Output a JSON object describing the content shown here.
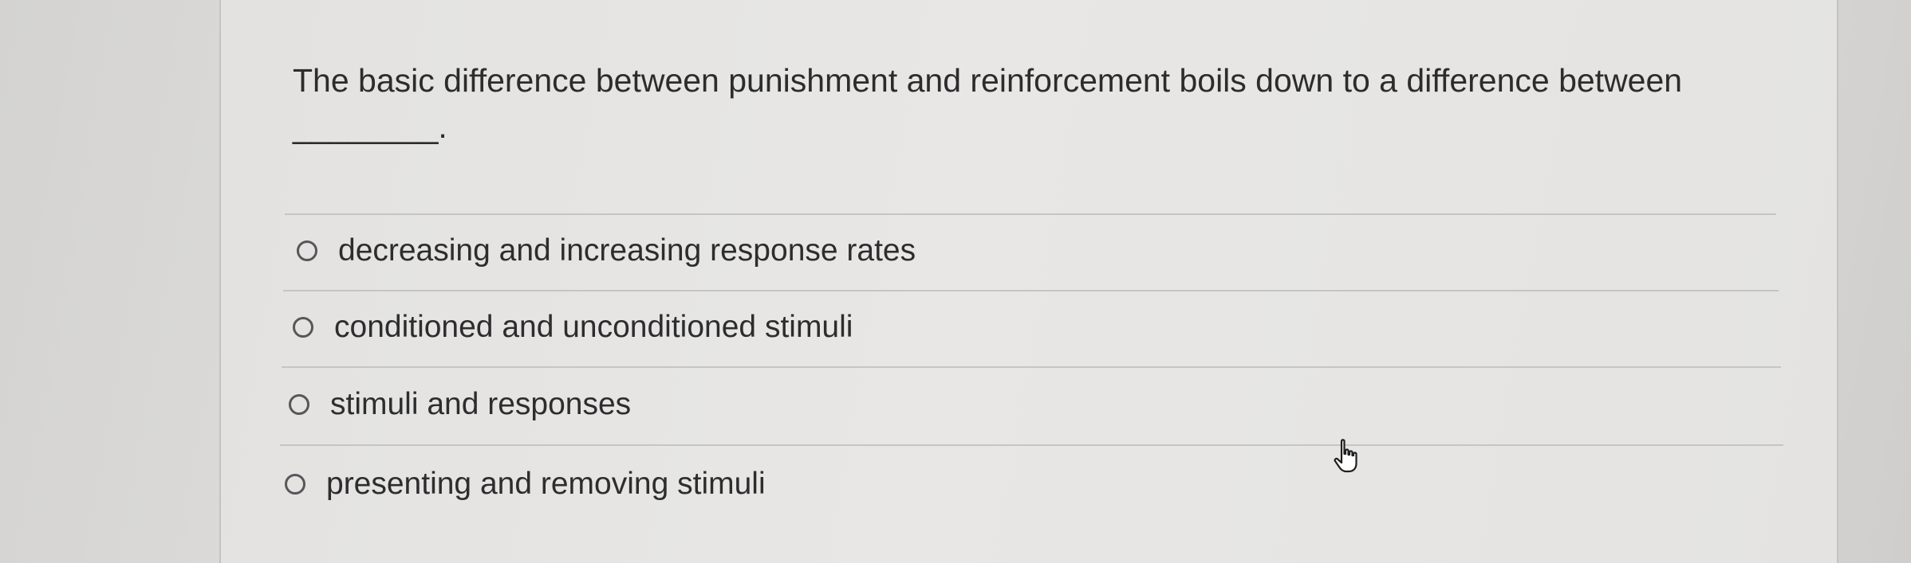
{
  "question": {
    "text": "The basic difference between punishment and reinforcement boils down to a difference between ________."
  },
  "options": [
    {
      "label": "decreasing and increasing response rates",
      "selected": false
    },
    {
      "label": "conditioned and unconditioned stimuli",
      "selected": false
    },
    {
      "label": "stimuli and responses",
      "selected": false
    },
    {
      "label": "presenting and removing stimuli",
      "selected": false
    }
  ],
  "icons": {
    "radio": "radio-empty-icon",
    "cursor": "hand-pointer-cursor-icon"
  }
}
